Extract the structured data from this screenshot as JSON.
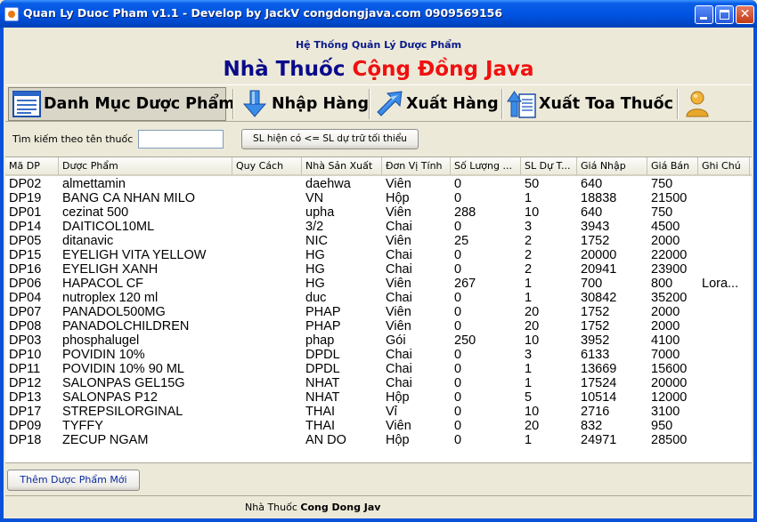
{
  "window": {
    "title": "Quan Ly Duoc Pham v1.1 - Develop by JackV congdongjava.com 0909569156"
  },
  "header": {
    "system_name": "Hệ Thống Quản Lý Dược Phẩm",
    "brand_part1": "Nhà Thuốc",
    "brand_part2": "Cộng Đồng Java",
    "brand_color1": "#0A0A8A",
    "brand_color2": "#F01010"
  },
  "toolbar": {
    "items": [
      {
        "label": "Danh Mục Dược Phẩm",
        "icon": "list-document-icon",
        "active": true
      },
      {
        "label": "Nhập Hàng",
        "icon": "arrow-down-icon"
      },
      {
        "label": "Xuất Hàng",
        "icon": "arrow-up-right-icon"
      },
      {
        "label": "Xuất Toa Thuốc",
        "icon": "arrow-up-document-icon"
      },
      {
        "label": "",
        "icon": "user-icon"
      }
    ]
  },
  "search": {
    "label": "Tìm kiếm theo tên thuốc",
    "value": "",
    "filter_button": "SL hiện có <= SL dự trữ tối thiểu"
  },
  "table": {
    "headers": [
      "Mã DP",
      "Dược Phẩm",
      "Quy Cách",
      "Nhà Sản Xuất",
      "Đơn Vị Tính",
      "Số Lượng ...",
      "SL Dự T...",
      "Giá Nhập",
      "Giá Bán",
      "Ghi Chú"
    ],
    "rows": [
      [
        "DP02",
        "almettamin",
        "",
        "daehwa",
        "Viên",
        "0",
        "50",
        "640",
        "750",
        ""
      ],
      [
        "DP19",
        "BANG CA NHAN MILO",
        "",
        "VN",
        "Hộp",
        "0",
        "1",
        "18838",
        "21500",
        ""
      ],
      [
        "DP01",
        "cezinat 500",
        "",
        "upha",
        "Viên",
        "288",
        "10",
        "640",
        "750",
        ""
      ],
      [
        "DP14",
        "DAITICOL10ML",
        "",
        "3/2",
        "Chai",
        "0",
        "3",
        "3943",
        "4500",
        ""
      ],
      [
        "DP05",
        "ditanavic",
        "",
        "NIC",
        "Viên",
        "25",
        "2",
        "1752",
        "2000",
        ""
      ],
      [
        "DP15",
        "EYELIGH VITA YELLOW",
        "",
        "HG",
        "Chai",
        "0",
        "2",
        "20000",
        "22000",
        ""
      ],
      [
        "DP16",
        "EYELIGH XANH",
        "",
        "HG",
        "Chai",
        "0",
        "2",
        "20941",
        "23900",
        ""
      ],
      [
        "DP06",
        "HAPACOL CF",
        "",
        "HG",
        "Viên",
        "267",
        "1",
        "700",
        "800",
        "Lora..."
      ],
      [
        "DP04",
        "nutroplex 120 ml",
        "",
        "duc",
        "Chai",
        "0",
        "1",
        "30842",
        "35200",
        ""
      ],
      [
        "DP07",
        "PANADOL500MG",
        "",
        "PHAP",
        "Viên",
        "0",
        "20",
        "1752",
        "2000",
        ""
      ],
      [
        "DP08",
        "PANADOLCHILDREN",
        "",
        "PHAP",
        "Viên",
        "0",
        "20",
        "1752",
        "2000",
        ""
      ],
      [
        "DP03",
        "phosphalugel",
        "",
        "phap",
        "Gói",
        "250",
        "10",
        "3952",
        "4100",
        ""
      ],
      [
        "DP10",
        "POVIDIN 10%",
        "",
        "DPDL",
        "Chai",
        "0",
        "3",
        "6133",
        "7000",
        ""
      ],
      [
        "DP11",
        "POVIDIN 10% 90 ML",
        "",
        "DPDL",
        "Chai",
        "0",
        "1",
        "13669",
        "15600",
        ""
      ],
      [
        "DP12",
        "SALONPAS GEL15G",
        "",
        "NHAT",
        "Chai",
        "0",
        "1",
        "17524",
        "20000",
        ""
      ],
      [
        "DP13",
        "SALONPAS P12",
        "",
        "NHAT",
        "Hộp",
        "0",
        "5",
        "10514",
        "12000",
        ""
      ],
      [
        "DP17",
        "STREPSILORGINAL",
        "",
        "THAI",
        "Vỉ",
        "0",
        "10",
        "2716",
        "3100",
        ""
      ],
      [
        "DP09",
        "TYFFY",
        "",
        "THAI",
        "Viên",
        "0",
        "20",
        "832",
        "950",
        ""
      ],
      [
        "DP18",
        "ZECUP NGAM",
        "",
        "AN DO",
        "Hộp",
        "0",
        "1",
        "24971",
        "28500",
        ""
      ]
    ]
  },
  "footer": {
    "add_button": "Thêm Dược Phẩm Mới",
    "status_prefix": "Nhà Thuốc",
    "status_bold": "Cong Dong Jav"
  }
}
